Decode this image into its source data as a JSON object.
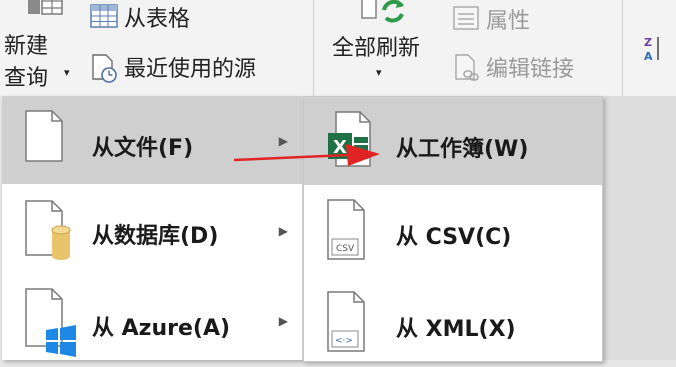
{
  "ribbon": {
    "new_query": {
      "line1": "新建",
      "line2": "查询",
      "arrow": "▾"
    },
    "from_table": "从表格",
    "recent_sources": "最近使用的源",
    "refresh_all": {
      "label": "全部刷新",
      "arrow": "▾"
    },
    "properties": "属性",
    "edit_links": "编辑链接"
  },
  "menu": {
    "items": [
      {
        "label": "从文件(F)",
        "icon": "document-icon",
        "caret": "▶"
      },
      {
        "label": "从数据库(D)",
        "icon": "database-document-icon",
        "caret": "▶"
      },
      {
        "label": "从 Azure(A)",
        "icon": "windows-azure-icon",
        "caret": "▶"
      }
    ]
  },
  "submenu": {
    "items": [
      {
        "label": "从工作簿(W)",
        "icon": "excel-workbook-icon"
      },
      {
        "label": "从 CSV(C)",
        "icon": "csv-file-icon",
        "badge": "CSV"
      },
      {
        "label": "从 XML(X)",
        "icon": "xml-file-icon"
      }
    ]
  },
  "colors": {
    "highlight": "#cfcfcf",
    "excel_green": "#1e7145",
    "arrow_red": "#e02424",
    "refresh_green": "#2e9a4a",
    "windows_blue": "#1e88e5",
    "database_gold": "#e8c46a"
  }
}
